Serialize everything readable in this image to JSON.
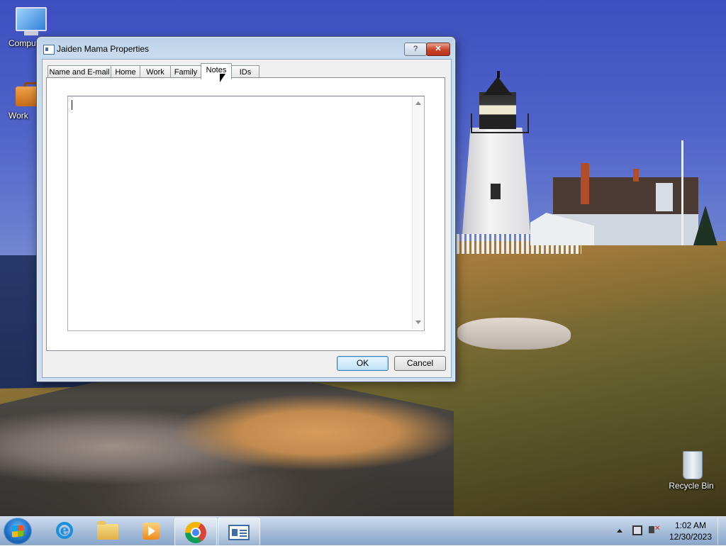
{
  "desktop": {
    "icons": [
      {
        "label": "Computer"
      },
      {
        "label": "Work"
      },
      {
        "label": "Recycle Bin"
      }
    ]
  },
  "dialog": {
    "title": "Jaiden Mama Properties",
    "help_glyph": "?",
    "close_glyph": "✕",
    "tabs": [
      {
        "label": "Name and E-mail"
      },
      {
        "label": "Home"
      },
      {
        "label": "Work"
      },
      {
        "label": "Family"
      },
      {
        "label": "Notes",
        "active": true
      },
      {
        "label": "IDs"
      }
    ],
    "notes_value": "",
    "ok_label": "OK",
    "cancel_label": "Cancel"
  },
  "taskbar": {
    "items": [
      {
        "icon": "internet-explorer-icon"
      },
      {
        "icon": "file-explorer-icon"
      },
      {
        "icon": "media-player-icon"
      },
      {
        "icon": "chrome-icon"
      },
      {
        "icon": "contact-card-icon",
        "active": true
      }
    ],
    "clock": {
      "time": "1:02 AM",
      "date": "12/30/2023"
    }
  },
  "colors": {
    "accent": "#3c7fb1",
    "close_red": "#c7442d",
    "dialog_frame": "#cfdff1"
  }
}
